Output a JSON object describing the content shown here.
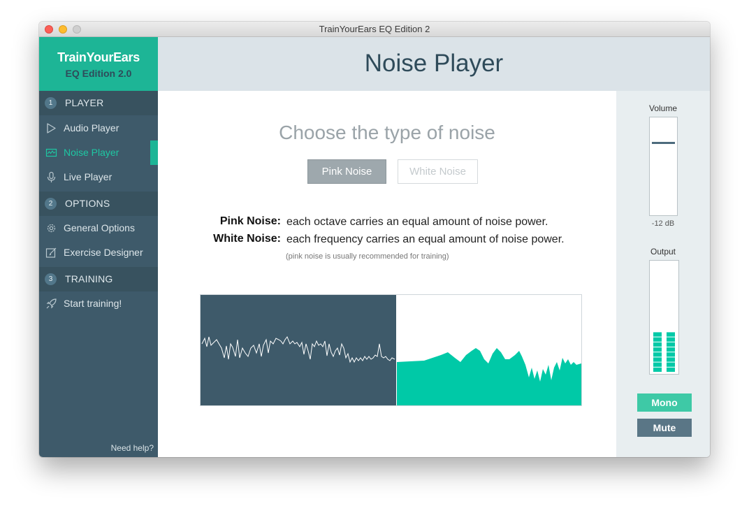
{
  "window": {
    "title": "TrainYourEars EQ Edition 2"
  },
  "brand": {
    "name": "TrainYourEars",
    "edition": "EQ Edition 2.0"
  },
  "sidebar": {
    "sections": [
      {
        "number": "1",
        "label": "PLAYER"
      },
      {
        "number": "2",
        "label": "OPTIONS"
      },
      {
        "number": "3",
        "label": "TRAINING"
      }
    ],
    "items": [
      {
        "label": "Audio Player",
        "icon": "play-icon"
      },
      {
        "label": "Noise Player",
        "icon": "waveform-icon",
        "active": true
      },
      {
        "label": "Live Player",
        "icon": "microphone-icon"
      },
      {
        "label": "General Options",
        "icon": "gear-icon"
      },
      {
        "label": "Exercise Designer",
        "icon": "edit-icon"
      },
      {
        "label": "Start training!",
        "icon": "rocket-icon"
      }
    ],
    "help": "Need help?"
  },
  "header": {
    "title": "Noise Player"
  },
  "main": {
    "heading": "Choose the type of noise",
    "buttons": {
      "pink": "Pink Noise",
      "white": "White Noise",
      "selected": "Pink Noise"
    },
    "descriptions": [
      {
        "term": "Pink Noise:",
        "text": "each octave carries an equal amount of noise power."
      },
      {
        "term": "White Noise:",
        "text": "each frequency carries an equal amount of noise power."
      }
    ],
    "note": "(pink noise is usually recommended for training)"
  },
  "right_panel": {
    "volume_label": "Volume",
    "volume_value": "-12 dB",
    "volume_level": 0.75,
    "output_label": "Output",
    "output_level": 0.38,
    "mono_label": "Mono",
    "mute_label": "Mute"
  },
  "colors": {
    "accent": "#1db596",
    "sidebar": "#3e5a6a",
    "waveform_bg": "#3e5a6a",
    "spectrum": "#00c9a7"
  }
}
